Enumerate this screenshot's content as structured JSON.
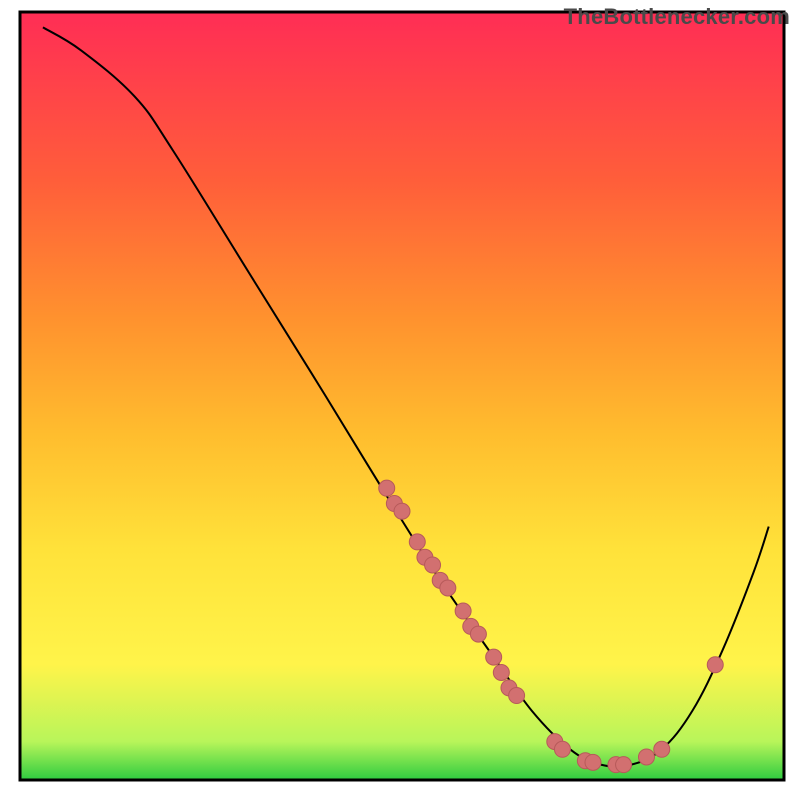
{
  "watermark": "TheBottlenecker.com",
  "chart_data": {
    "type": "line",
    "title": "",
    "xlabel": "",
    "ylabel": "",
    "xlim": [
      0,
      100
    ],
    "ylim": [
      0,
      100
    ],
    "background_gradient_stops": [
      {
        "y": 0.0,
        "color": "#2ecc40"
      },
      {
        "y": 0.05,
        "color": "#b8f55a"
      },
      {
        "y": 0.15,
        "color": "#fff44a"
      },
      {
        "y": 0.3,
        "color": "#ffe23a"
      },
      {
        "y": 0.45,
        "color": "#ffbd2e"
      },
      {
        "y": 0.6,
        "color": "#ff922e"
      },
      {
        "y": 0.78,
        "color": "#ff5e3a"
      },
      {
        "y": 1.0,
        "color": "#ff2d55"
      }
    ],
    "curve": [
      {
        "x": 3,
        "y": 98
      },
      {
        "x": 8,
        "y": 95
      },
      {
        "x": 15,
        "y": 89
      },
      {
        "x": 20,
        "y": 82
      },
      {
        "x": 30,
        "y": 66
      },
      {
        "x": 40,
        "y": 50
      },
      {
        "x": 48,
        "y": 37
      },
      {
        "x": 55,
        "y": 26
      },
      {
        "x": 62,
        "y": 16
      },
      {
        "x": 67,
        "y": 9
      },
      {
        "x": 72,
        "y": 4
      },
      {
        "x": 76,
        "y": 2
      },
      {
        "x": 80,
        "y": 2
      },
      {
        "x": 84,
        "y": 4
      },
      {
        "x": 88,
        "y": 9
      },
      {
        "x": 92,
        "y": 17
      },
      {
        "x": 96,
        "y": 27
      },
      {
        "x": 98,
        "y": 33
      }
    ],
    "markers": [
      {
        "x": 48,
        "y": 38
      },
      {
        "x": 49,
        "y": 36
      },
      {
        "x": 50,
        "y": 35
      },
      {
        "x": 52,
        "y": 31
      },
      {
        "x": 53,
        "y": 29
      },
      {
        "x": 54,
        "y": 28
      },
      {
        "x": 55,
        "y": 26
      },
      {
        "x": 56,
        "y": 25
      },
      {
        "x": 58,
        "y": 22
      },
      {
        "x": 59,
        "y": 20
      },
      {
        "x": 60,
        "y": 19
      },
      {
        "x": 62,
        "y": 16
      },
      {
        "x": 63,
        "y": 14
      },
      {
        "x": 64,
        "y": 12
      },
      {
        "x": 65,
        "y": 11
      },
      {
        "x": 70,
        "y": 5
      },
      {
        "x": 71,
        "y": 4
      },
      {
        "x": 74,
        "y": 2.5
      },
      {
        "x": 75,
        "y": 2.3
      },
      {
        "x": 78,
        "y": 2.0
      },
      {
        "x": 79,
        "y": 2.0
      },
      {
        "x": 82,
        "y": 3.0
      },
      {
        "x": 84,
        "y": 4.0
      },
      {
        "x": 91,
        "y": 15.0
      }
    ],
    "marker_style": {
      "fill": "#d27070",
      "stroke": "#b75a5a",
      "radius_pct": 1.0
    },
    "line_style": {
      "stroke": "#000000",
      "width": 2
    },
    "axes_box": {
      "left_pct": 2.5,
      "right_pct": 98.0,
      "bottom_pct": 2.5,
      "top_pct": 98.5
    }
  }
}
